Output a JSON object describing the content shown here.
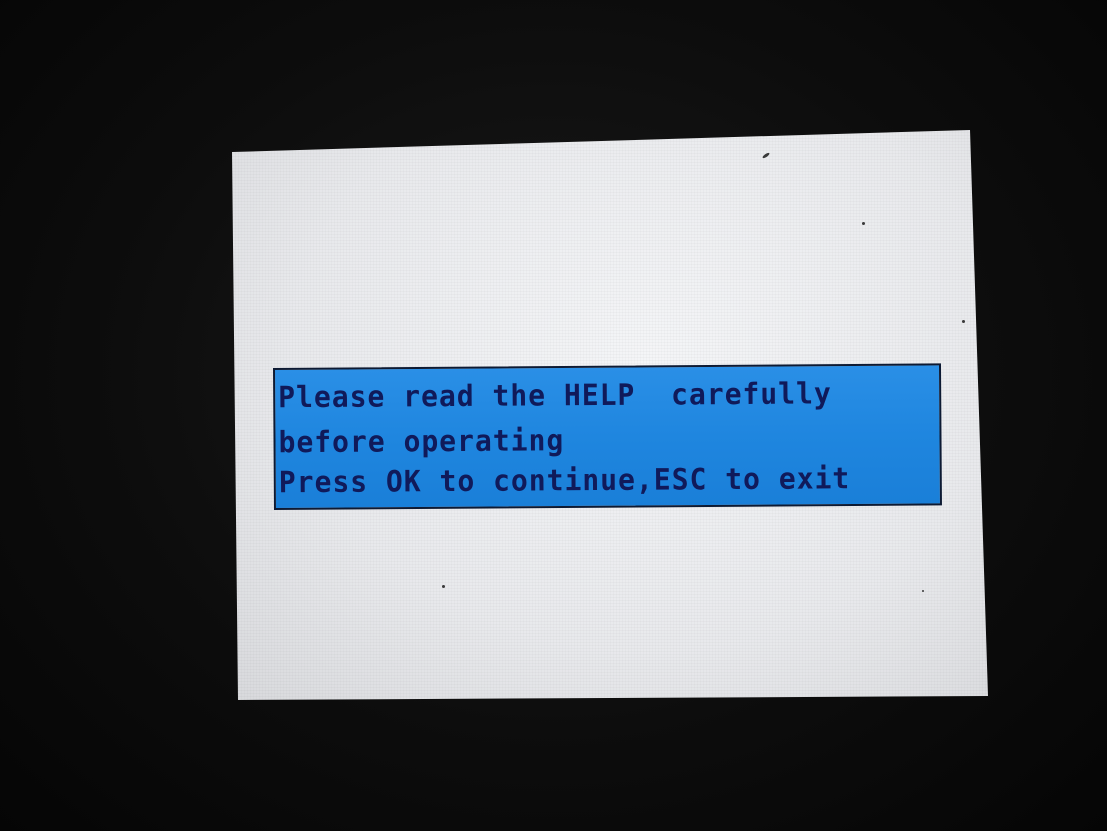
{
  "dialog": {
    "lines": [
      "Please read the HELP  carefully",
      "before operating",
      "Press OK to continue,ESC to exit"
    ]
  },
  "colors": {
    "dialog_background": "#1f86df",
    "dialog_text": "#101a5a",
    "screen_background": "#ecedef",
    "bezel": "#0b0b0b"
  }
}
